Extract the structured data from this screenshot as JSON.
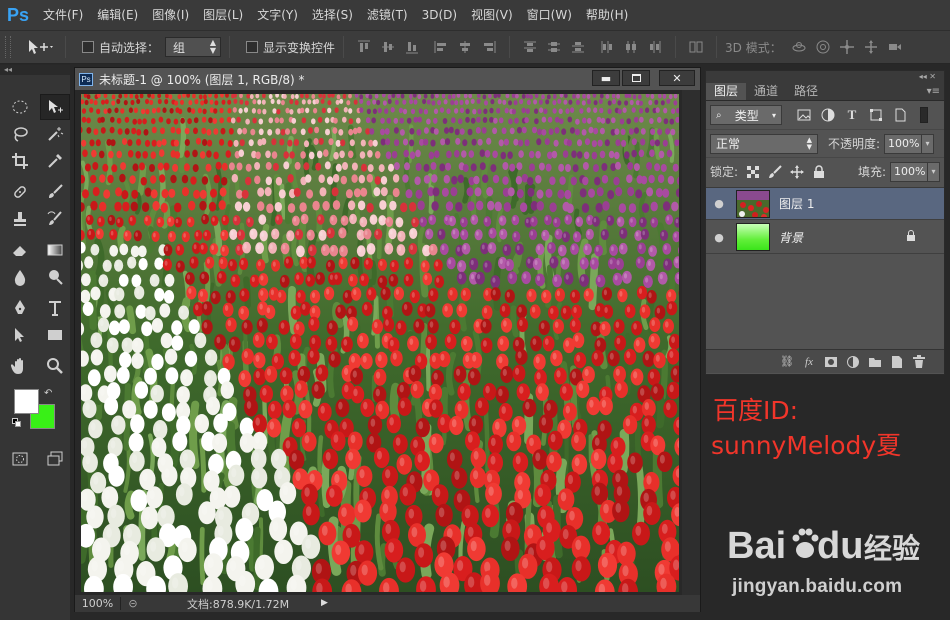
{
  "app": {
    "logo": "Ps"
  },
  "menu": [
    "文件(F)",
    "编辑(E)",
    "图像(I)",
    "图层(L)",
    "文字(Y)",
    "选择(S)",
    "滤镜(T)",
    "3D(D)",
    "视图(V)",
    "窗口(W)",
    "帮助(H)"
  ],
  "options": {
    "auto_select_label": "自动选择：",
    "auto_select_value": "组",
    "show_transform_label": "显示变换控件",
    "mode_3d_label": "3D 模式："
  },
  "document": {
    "title": "未标题-1 @ 100% (图层 1, RGB/8) *",
    "zoom": "100%",
    "doc_info": "文档:878.9K/1.72M"
  },
  "layers_panel": {
    "tabs": [
      "图层",
      "通道",
      "路径"
    ],
    "filter_kind": "类型",
    "blend_mode": "正常",
    "opacity_label": "不透明度:",
    "opacity": "100%",
    "lock_label": "锁定:",
    "fill_label": "填充:",
    "fill": "100%",
    "layers": [
      {
        "name": "图层 1",
        "selected": true,
        "visible": true
      },
      {
        "name": "背景",
        "selected": false,
        "visible": true,
        "locked": true
      }
    ]
  },
  "colors": {
    "foreground": "#ffffff",
    "background": "#39f017",
    "accent": "#39a3f5",
    "watermark": "#f1352a"
  },
  "watermark": {
    "id_line": "百度ID:",
    "name_line": "sunnyMelody夏",
    "baidu_logo_text": "Bai",
    "baidu_logo_text2": "du",
    "baidu_logo_suffix": "经验",
    "url": "jingyan.baidu.com"
  }
}
